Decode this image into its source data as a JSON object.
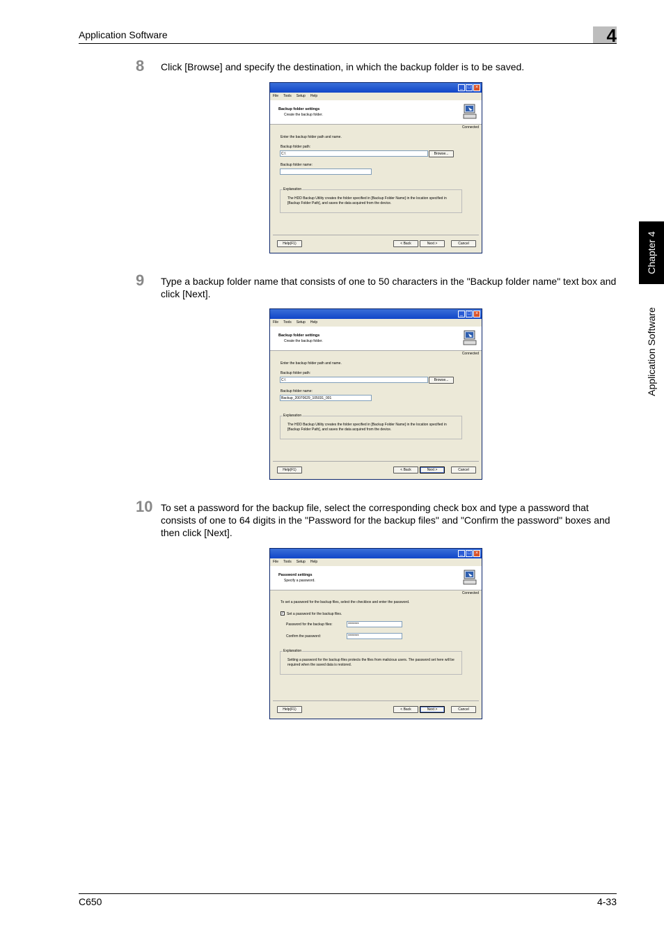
{
  "header": {
    "title": "Application Software",
    "chapter_num": "4"
  },
  "side": {
    "tab_label": "Chapter 4",
    "section_label": "Application Software"
  },
  "steps": [
    {
      "num": "8",
      "text": "Click [Browse] and specify the destination, in which the backup folder is to be saved."
    },
    {
      "num": "9",
      "text": "Type a backup folder name that consists of one to 50 characters in the \"Backup folder name\" text box and click [Next]."
    },
    {
      "num": "10",
      "text": "To set a password for the backup file, select the corresponding check box and type a password that consists of one to 64 digits in the \"Password for the backup files\" and \"Confirm the password\" boxes and then click [Next]."
    }
  ],
  "dialog_common": {
    "menu": [
      "File",
      "Tools",
      "Setup",
      "Help"
    ],
    "connected": "Connected",
    "help_btn": "Help(F1)",
    "back_btn": "< Back",
    "next_btn": "Next >",
    "cancel_btn": "Cancel",
    "browse_btn": "Browse...",
    "explanation_title": "Explanation"
  },
  "dialog1": {
    "head_title": "Backup folder settings",
    "head_sub": "Create the backup folder.",
    "intro": "Enter the backup folder path and name.",
    "path_label": "Backup folder path:",
    "path_value": "C:\\",
    "name_label": "Backup folder name:",
    "name_value": "",
    "explanation": "The HDD Backup Utility creates the folder specified in [Backup Folder Name] in the location specified in [Backup Folder Path], and saves the data acquired from the device."
  },
  "dialog2": {
    "head_title": "Backup folder settings",
    "head_sub": "Create the backup folder.",
    "intro": "Enter the backup folder path and name.",
    "path_label": "Backup folder path:",
    "path_value": "C:\\",
    "name_label": "Backup folder name:",
    "name_value": "Backup_20070629_105031_001",
    "explanation": "The HDD Backup Utility creates the folder specified in [Backup Folder Name] in the location specified in [Backup Folder Path], and saves the data acquired from the device."
  },
  "dialog3": {
    "head_title": "Password settings",
    "head_sub": "Specify a password.",
    "intro": "To set a password for the backup files, select the checkbox and enter the password.",
    "checkbox_label": "Set a password for the backup files.",
    "checkbox_mark": "✓",
    "pw_label": "Password for the backup files:",
    "pw_value": "********",
    "confirm_label": "Confirm the password:",
    "confirm_value": "********",
    "explanation": "Setting a password for the backup files protects the files from malicious users. The password set here will be required when the saved data is restored."
  },
  "footer": {
    "left": "C650",
    "right": "4-33"
  }
}
